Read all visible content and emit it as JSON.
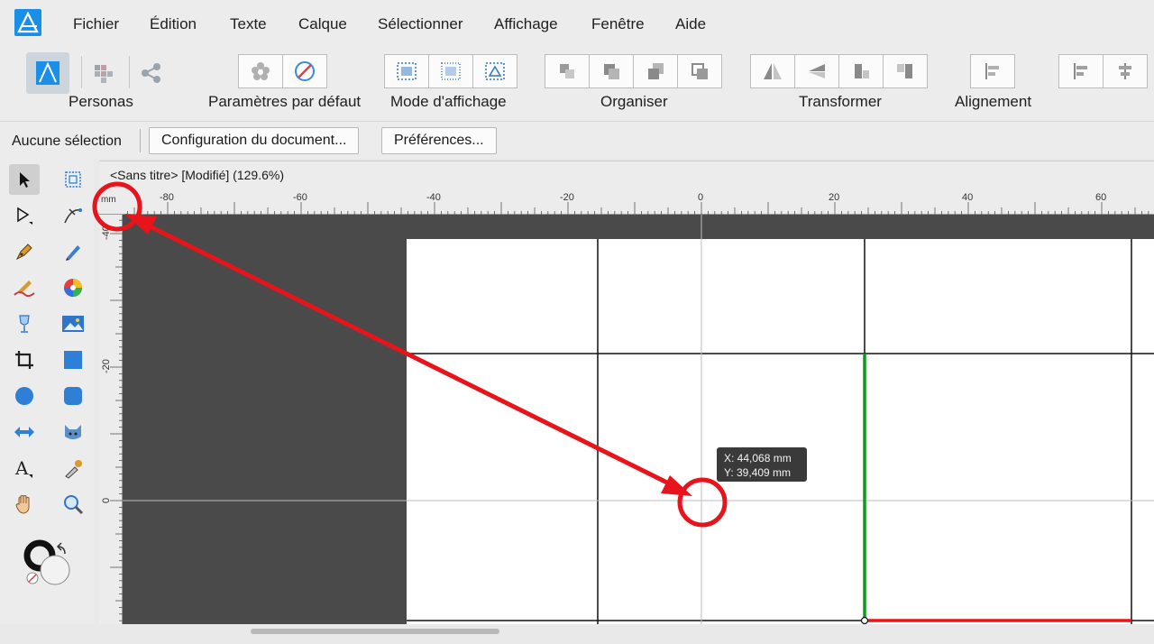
{
  "menu": {
    "items": [
      "Fichier",
      "Édition",
      "Texte",
      "Calque",
      "Sélectionner",
      "Affichage",
      "Fenêtre",
      "Aide"
    ]
  },
  "toolbar": {
    "personas_label": "Personas",
    "defaults_label": "Paramètres par défaut",
    "view_mode_label": "Mode d'affichage",
    "arrange_label": "Organiser",
    "transform_label": "Transformer",
    "align_label": "Alignement"
  },
  "context": {
    "no_selection": "Aucune sélection",
    "doc_setup_button": "Configuration du document...",
    "preferences_button": "Préférences..."
  },
  "document": {
    "title": "<Sans titre> [Modifié] (129.6%)",
    "ruler_unit": "mm",
    "h_ruler_labels": [
      "-80",
      "-60",
      "-40",
      "-20",
      "0",
      "20",
      "40",
      "60"
    ],
    "v_ruler_labels": [
      "-40",
      "-20",
      "0"
    ]
  },
  "tooltip": {
    "x_readout": "X: 44,068 mm",
    "y_readout": "Y: 39,409 mm"
  },
  "colors": {
    "accent": "#1a8fe8",
    "annotation": "#e8141b",
    "green_guide": "#0e9a1a",
    "red_guide": "#e8141b",
    "canvas_bg": "#4a4a4a"
  }
}
